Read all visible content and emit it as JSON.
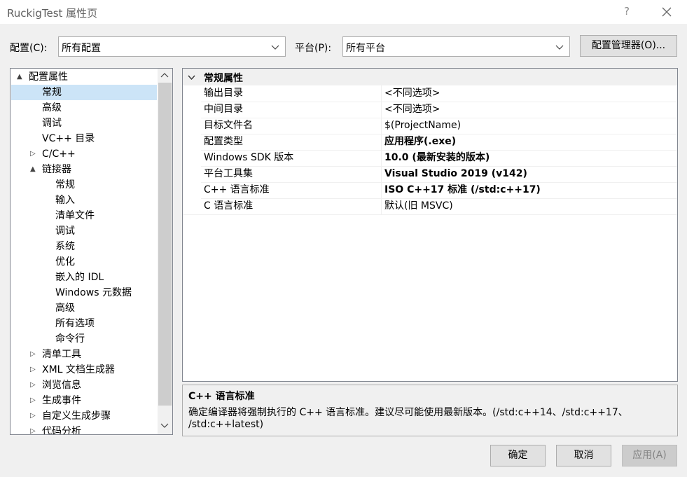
{
  "window": {
    "title": "RuckigTest 属性页",
    "help": "?"
  },
  "config": {
    "config_label": "配置(C):",
    "config_value": "所有配置",
    "platform_label": "平台(P):",
    "platform_value": "所有平台",
    "manager_button": "配置管理器(O)..."
  },
  "tree": {
    "items": [
      {
        "label": "配置属性",
        "twisty": "▲"
      },
      {
        "label": "常规"
      },
      {
        "label": "高级"
      },
      {
        "label": "调试"
      },
      {
        "label": "VC++ 目录"
      },
      {
        "label": "C/C++",
        "twisty": "▷"
      },
      {
        "label": "链接器",
        "twisty": "▲"
      },
      {
        "label": "常规"
      },
      {
        "label": "输入"
      },
      {
        "label": "清单文件"
      },
      {
        "label": "调试"
      },
      {
        "label": "系统"
      },
      {
        "label": "优化"
      },
      {
        "label": "嵌入的 IDL"
      },
      {
        "label": "Windows 元数据"
      },
      {
        "label": "高级"
      },
      {
        "label": "所有选项"
      },
      {
        "label": "命令行"
      },
      {
        "label": "清单工具",
        "twisty": "▷"
      },
      {
        "label": "XML 文档生成器",
        "twisty": "▷"
      },
      {
        "label": "浏览信息",
        "twisty": "▷"
      },
      {
        "label": "生成事件",
        "twisty": "▷"
      },
      {
        "label": "自定义生成步骤",
        "twisty": "▷"
      },
      {
        "label": "代码分析",
        "twisty": "▷"
      }
    ]
  },
  "grid": {
    "category": "常规属性",
    "rows": [
      {
        "name": "输出目录",
        "value": "<不同选项>"
      },
      {
        "name": "中间目录",
        "value": "<不同选项>"
      },
      {
        "name": "目标文件名",
        "value": "$(ProjectName)"
      },
      {
        "name": "配置类型",
        "value": "应用程序(.exe)"
      },
      {
        "name": "Windows SDK 版本",
        "value": "10.0 (最新安装的版本)"
      },
      {
        "name": "平台工具集",
        "value": "Visual Studio 2019 (v142)"
      },
      {
        "name": "C++ 语言标准",
        "value": "ISO C++17 标准 (/std:c++17)"
      },
      {
        "name": "C 语言标准",
        "value": "默认(旧 MSVC)"
      }
    ]
  },
  "description": {
    "title": "C++ 语言标准",
    "line1": "确定编译器将强制执行的 C++ 语言标准。建议尽可能使用最新版本。(/std:c++14、/std:c++17、",
    "line2": "/std:c++latest)"
  },
  "buttons": {
    "ok": "确定",
    "cancel": "取消",
    "apply": "应用(A)"
  }
}
